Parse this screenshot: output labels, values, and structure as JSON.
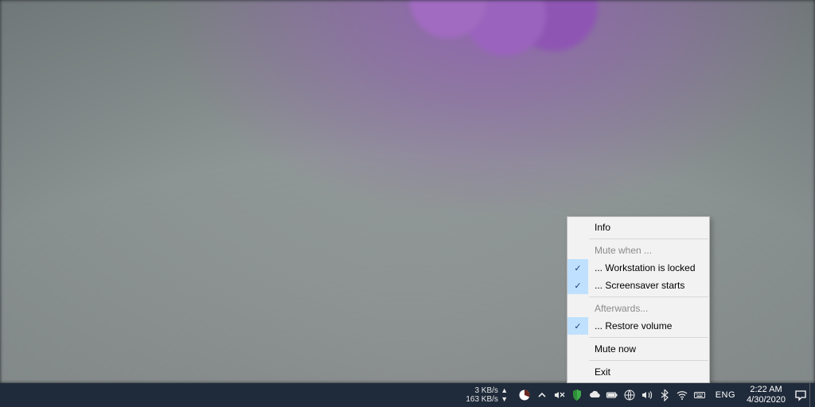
{
  "context_menu": {
    "info": "Info",
    "mute_when_header": "Mute when ...",
    "workstation_locked": "... Workstation is locked",
    "screensaver_starts": "... Screensaver starts",
    "afterwards_header": "Afterwards...",
    "restore_volume": "... Restore volume",
    "mute_now": "Mute now",
    "exit": "Exit"
  },
  "netmon": {
    "up": "3 KB/s",
    "down": "163 KB/s"
  },
  "taskbar": {
    "language": "ENG",
    "time": "2:22 AM",
    "date": "4/30/2020"
  }
}
